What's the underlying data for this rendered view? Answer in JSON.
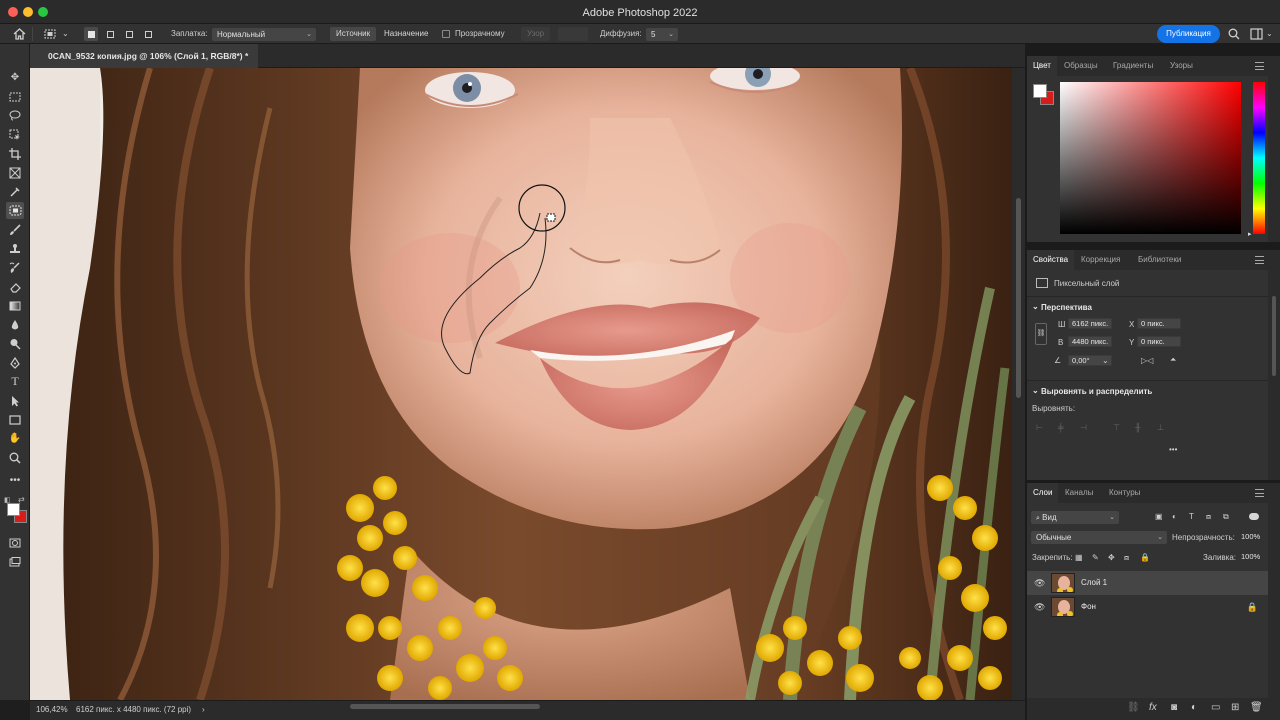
{
  "app": {
    "title": "Adobe Photoshop 2022"
  },
  "options": {
    "patch_label": "Заплатка:",
    "mode_value": "Нормальный",
    "source_label": "Источник",
    "destination_label": "Назначение",
    "transparent_label": "Прозрачному",
    "pattern_label": "Узор",
    "diffusion_label": "Диффузия:",
    "diffusion_value": "5",
    "publish_label": "Публикация"
  },
  "document": {
    "tab_title": "0CAN_9532 копия.jpg @ 106% (Слой 1, RGB/8*) *",
    "zoom": "106,42%",
    "dimensions": "6162 пикс. x 4480 пикс. (72 ppi)",
    "status_chevron": "›"
  },
  "color_panel": {
    "tabs": [
      "Цвет",
      "Образцы",
      "Градиенты",
      "Узоры"
    ],
    "foreground": "#ffffff",
    "background": "#d81b1b",
    "hue": "#ff0000"
  },
  "properties_panel": {
    "tabs": [
      "Свойства",
      "Коррекция",
      "Библиотеки"
    ],
    "layer_type": "Пиксельный слой",
    "perspective_title": "Перспектива",
    "w_label": "Ш",
    "w_value": "6162 пикс.",
    "h_label": "В",
    "h_value": "4480 пикс.",
    "x_label": "X",
    "x_value": "0 пикс.",
    "y_label": "Y",
    "y_value": "0 пикс.",
    "angle_value": "0,00°",
    "align_title": "Выровнять и распределить",
    "align_label": "Выровнять:",
    "more": "•••"
  },
  "layers_panel": {
    "tabs": [
      "Слои",
      "Каналы",
      "Контуры"
    ],
    "filter_value": "Вид",
    "blend_mode": "Обычные",
    "opacity_label": "Непрозрачность:",
    "opacity_value": "100%",
    "lock_label": "Закрепить:",
    "fill_label": "Заливка:",
    "fill_value": "100%",
    "layers": [
      {
        "name": "Слой 1",
        "selected": true,
        "locked": false
      },
      {
        "name": "Фон",
        "selected": false,
        "locked": true
      }
    ]
  },
  "icons": {
    "home": "home-icon",
    "search": "search-icon",
    "workspace": "workspace-icon"
  }
}
